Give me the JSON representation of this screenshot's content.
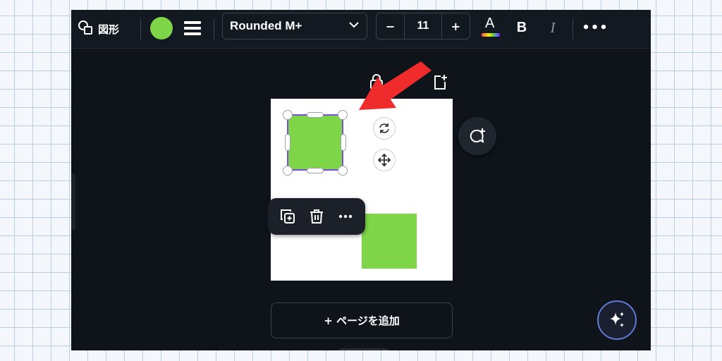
{
  "toolbar": {
    "shape_label": "図形",
    "font_name": "Rounded M+",
    "font_size": "11",
    "minus_label": "−",
    "plus_label": "+",
    "bold_label": "B",
    "italic_label": "I",
    "text_color_letter": "A",
    "more_label": "•••"
  },
  "canvas": {
    "add_page_label": "+ ページを追加",
    "shape_color": "#7ed548",
    "selection_color": "#7d4fd6"
  },
  "icons": [
    "shapes-icon",
    "color-swatch",
    "line-weight-icon",
    "chevron-down-icon",
    "text-color-icon",
    "lock-icon",
    "add-page-icon",
    "rotate-icon",
    "move-icon",
    "duplicate-icon",
    "trash-icon",
    "more-icon",
    "comment-add-icon",
    "magic-sparkle-icon",
    "red-arrow-annotation"
  ]
}
